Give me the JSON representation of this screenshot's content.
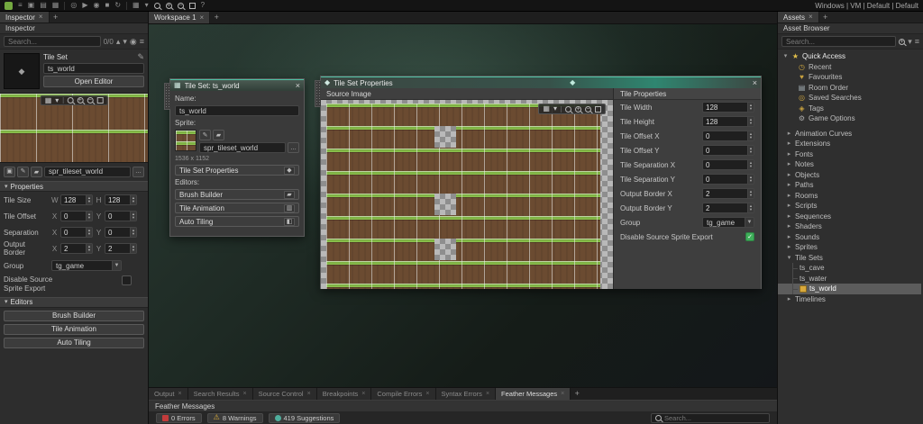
{
  "topbar": {
    "right_text": "Windows | VM | Default | Default"
  },
  "inspector": {
    "tab_label": "Inspector",
    "panel_title": "Inspector",
    "search_placeholder": "Search...",
    "search_count": "0/0",
    "asset_type": "Tile Set",
    "asset_name": "ts_world",
    "open_editor_label": "Open Editor",
    "sprite_name": "spr_tileset_world",
    "properties_header": "Properties",
    "property_rows": [
      {
        "label": "Tile Size",
        "k1": "W",
        "v1": "128",
        "k2": "H",
        "v2": "128"
      },
      {
        "label": "Tile Offset",
        "k1": "X",
        "v1": "0",
        "k2": "Y",
        "v2": "0"
      },
      {
        "label": "Separation",
        "k1": "X",
        "v1": "0",
        "k2": "Y",
        "v2": "0"
      },
      {
        "label": "Output Border",
        "k1": "X",
        "v1": "2",
        "k2": "Y",
        "v2": "2"
      }
    ],
    "group_label": "Group",
    "group_value": "tg_game",
    "disable_source_label": "Disable Source Sprite Export",
    "editors_header": "Editors",
    "editor_buttons": [
      "Brush Builder",
      "Tile Animation",
      "Auto Tiling"
    ]
  },
  "workspace": {
    "tab_label": "Workspace 1"
  },
  "tileset_window": {
    "title": "Tile Set: ts_world",
    "name_label": "Name:",
    "name_value": "ts_world",
    "sprite_label": "Sprite:",
    "sprite_name": "spr_tileset_world",
    "sprite_size": "1536 x 1152",
    "tile_set_properties_label": "Tile Set Properties",
    "editors_label": "Editors:",
    "editor_buttons": [
      {
        "label": "Brush Builder",
        "icon": "brush"
      },
      {
        "label": "Tile Animation",
        "icon": "film"
      },
      {
        "label": "Auto Tiling",
        "icon": "puzzle"
      }
    ]
  },
  "properties_window": {
    "title": "Tile Set Properties",
    "source_image_header": "Source Image",
    "tile_properties_header": "Tile Properties",
    "fields": [
      {
        "label": "Tile Width",
        "value": "128"
      },
      {
        "label": "Tile Height",
        "value": "128"
      },
      {
        "label": "Tile Offset X",
        "value": "0"
      },
      {
        "label": "Tile Offset Y",
        "value": "0"
      },
      {
        "label": "Tile Separation X",
        "value": "0"
      },
      {
        "label": "Tile Separation Y",
        "value": "0"
      },
      {
        "label": "Output Border X",
        "value": "2"
      },
      {
        "label": "Output Border Y",
        "value": "2"
      }
    ],
    "group_label": "Group",
    "group_value": "tg_game",
    "disable_source_label": "Disable Source Sprite Export"
  },
  "assets": {
    "tab_label": "Assets",
    "panel_title": "Asset Browser",
    "search_placeholder": "Search...",
    "quick_access_label": "Quick Access",
    "quick_access_items": [
      {
        "label": "Recent",
        "icon": "clock"
      },
      {
        "label": "Favourites",
        "icon": "heart"
      },
      {
        "label": "Room Order",
        "icon": "list"
      },
      {
        "label": "Saved Searches",
        "icon": "search"
      },
      {
        "label": "Tags",
        "icon": "tag"
      },
      {
        "label": "Game Options",
        "icon": "gear"
      }
    ],
    "folders": [
      "Animation Curves",
      "Extensions",
      "Fonts",
      "Notes",
      "Objects",
      "Paths",
      "Rooms",
      "Scripts",
      "Sequences",
      "Shaders",
      "Sounds",
      "Sprites"
    ],
    "tile_sets_label": "Tile Sets",
    "tile_set_items": [
      "ts_cave",
      "ts_water"
    ],
    "selected_item": "ts_world",
    "timelines_label": "Timelines"
  },
  "output": {
    "inactive_tabs": [
      "Output",
      "Search Results",
      "Source Control",
      "Breakpoints",
      "Compile Errors",
      "Syntax Errors"
    ],
    "active_tab": "Feather Messages",
    "panel_title": "Feather Messages",
    "errors_label": "0 Errors",
    "warnings_label": "8 Warnings",
    "suggestions_label": "419 Suggestions",
    "search_placeholder": "Search..."
  }
}
